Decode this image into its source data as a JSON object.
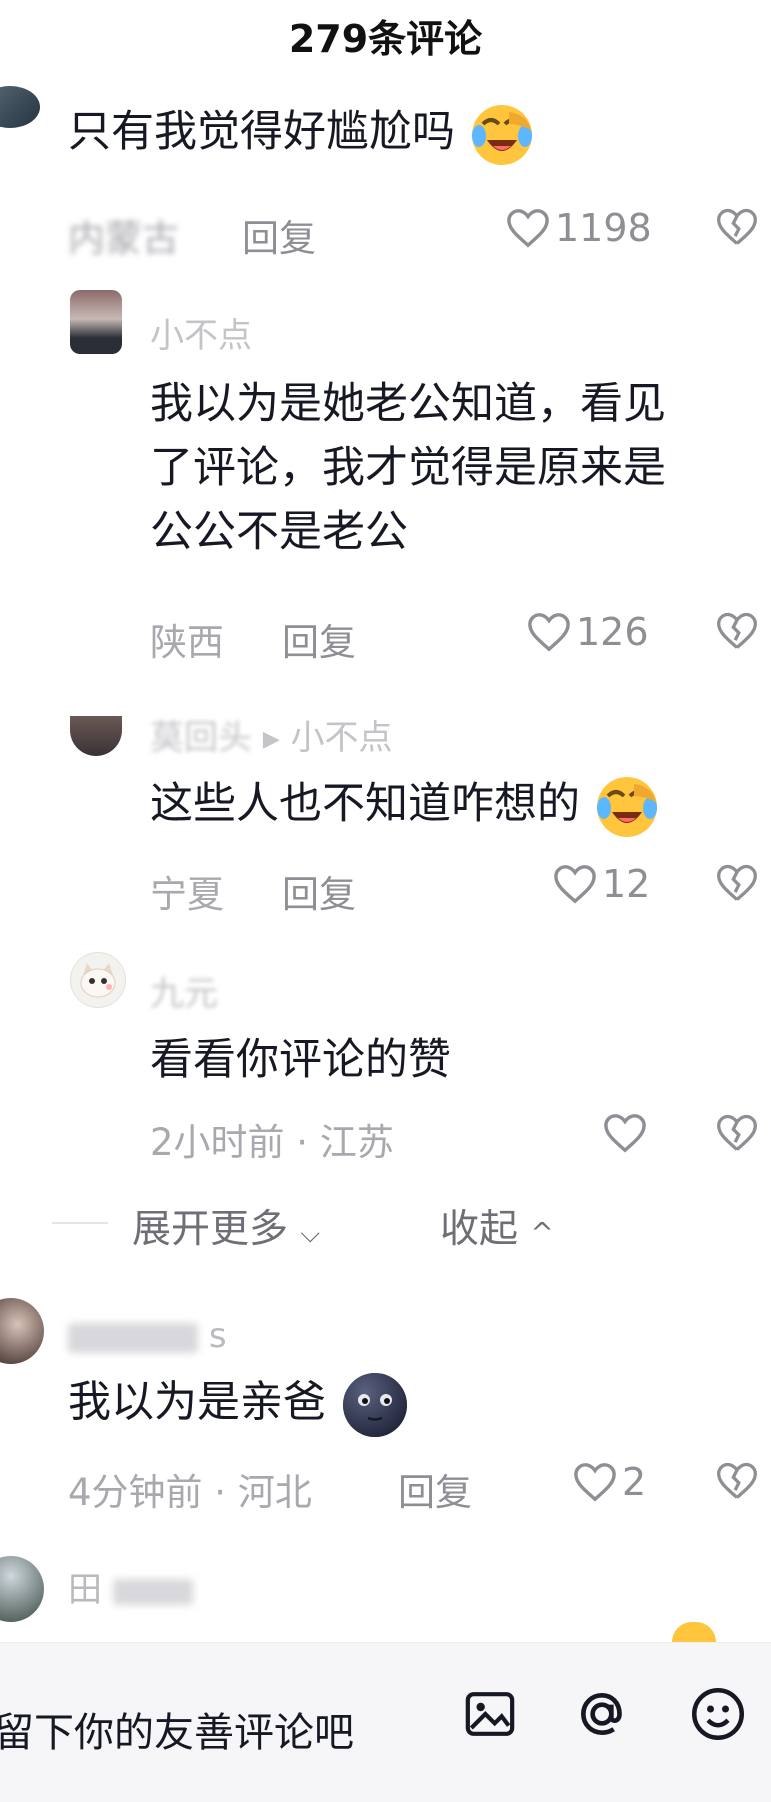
{
  "header": {
    "title": "279条评论"
  },
  "comments": [
    {
      "text": "只有我觉得好尴尬吗",
      "location": "内蒙古",
      "reply_label": "回复",
      "likes": "1198"
    },
    {
      "username": "小不点",
      "text_lines": [
        "我以为是她老公知道，看见",
        "了评论，我才觉得是原来是",
        "公公不是老公"
      ],
      "location": "陕西",
      "reply_label": "回复",
      "likes": "126"
    },
    {
      "username": "莫回头",
      "reply_to": "小不点",
      "text": "这些人也不知道咋想的",
      "location": "宁夏",
      "reply_label": "回复",
      "likes": "12"
    },
    {
      "username": "九元",
      "text": "看看你评论的赞",
      "meta": "2小时前 · 江苏"
    },
    {
      "username": "s",
      "text": "我以为是亲爸",
      "meta": "4分钟前 · 河北",
      "reply_label": "回复",
      "likes": "2"
    },
    {
      "username": "田"
    }
  ],
  "thread_controls": {
    "expand_more": "展开更多",
    "collapse": "收起"
  },
  "input": {
    "placeholder": "留下你的友善评论吧"
  },
  "colors": {
    "accent": "#161823",
    "muted": "#a8a8ae",
    "emoji": "#ffc63d"
  }
}
